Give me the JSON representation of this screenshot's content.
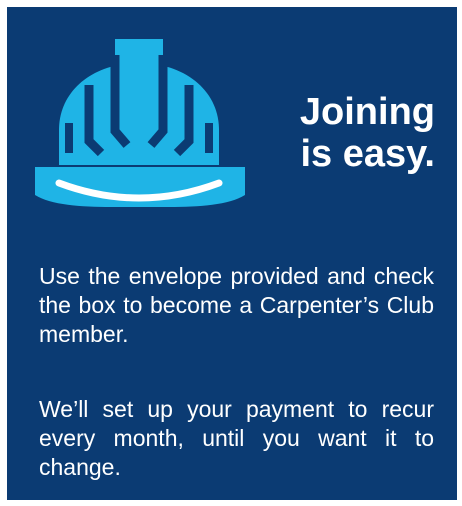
{
  "colors": {
    "background": "#0b3b73",
    "helmet": "#1fb4e6",
    "text": "#ffffff"
  },
  "icon": "hard-hat-icon",
  "headline": {
    "line1": "Joining",
    "line2": "is easy."
  },
  "paragraphs": [
    "Use the envelope provided and check the box to become a Carpenter’s Club member.",
    "We’ll set up your payment to recur every month, until you want it to change."
  ]
}
